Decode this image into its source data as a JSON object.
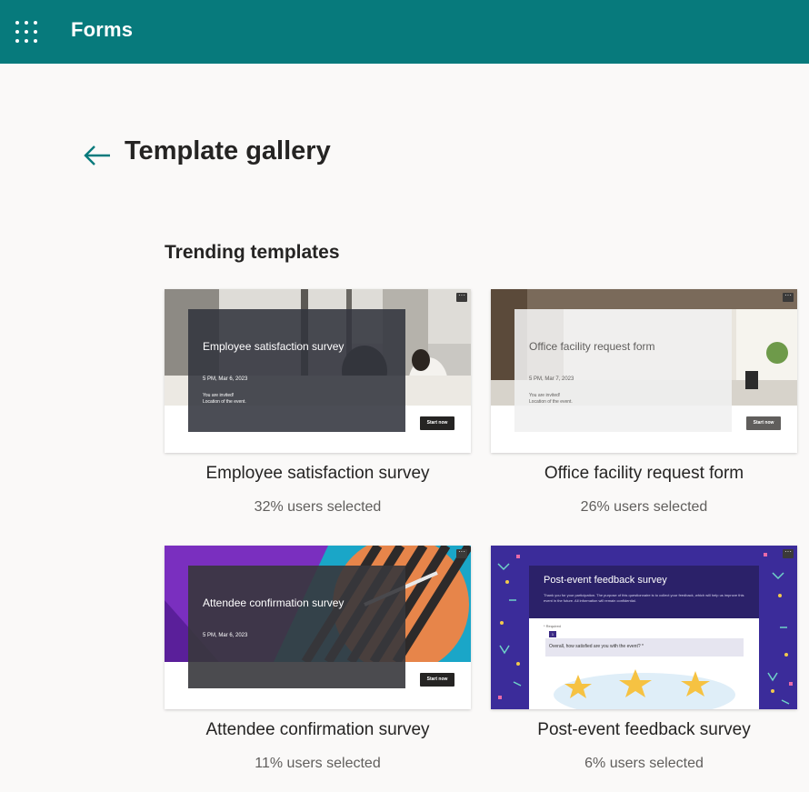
{
  "header": {
    "app_title": "Forms"
  },
  "page": {
    "title": "Template gallery",
    "section_title": "Trending templates"
  },
  "templates": [
    {
      "name": "Employee satisfaction survey",
      "stat": "32% users selected",
      "preview": {
        "title": "Employee satisfaction survey",
        "date": "5 PM, Mar 6, 2023",
        "invite_line1": "You are invited!",
        "invite_line2": "Location of the event.",
        "button": "Start now"
      }
    },
    {
      "name": "Office facility request form",
      "stat": "26% users selected",
      "preview": {
        "title": "Office facility request form",
        "date": "5 PM, Mar 7, 2023",
        "invite_line1": "You are invited!",
        "invite_line2": "Location of the event.",
        "button": "Start now"
      }
    },
    {
      "name": "Attendee confirmation survey",
      "stat": "11% users selected",
      "preview": {
        "title": "Attendee confirmation survey",
        "date": "5 PM, Mar 6, 2023",
        "button": "Start now"
      }
    },
    {
      "name": "Post-event feedback survey",
      "stat": "6% users selected",
      "preview": {
        "title": "Post-event feedback survey",
        "description": "Thank you for your participation. The purpose of this questionnaire is to collect your feedback, which will help us improve this event in the future. All information will remain confidential.",
        "required_label": "* Required",
        "question_number": "1",
        "question": "Overall, how satisfied are you with the event? *"
      }
    }
  ],
  "colors": {
    "header": "#077a7c",
    "background": "#faf9f8",
    "accent": "#077a7c"
  },
  "icons": {
    "app_launcher": "waffle-icon",
    "back": "back-arrow-icon",
    "more": "more-icon"
  }
}
